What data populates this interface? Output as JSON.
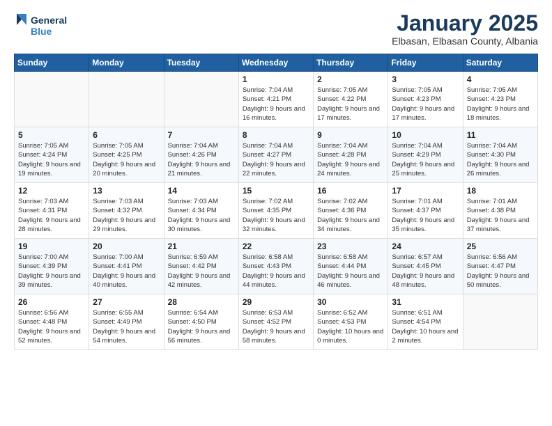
{
  "header": {
    "logo_line1": "General",
    "logo_line2": "Blue",
    "month": "January 2025",
    "location": "Elbasan, Elbasan County, Albania"
  },
  "weekdays": [
    "Sunday",
    "Monday",
    "Tuesday",
    "Wednesday",
    "Thursday",
    "Friday",
    "Saturday"
  ],
  "weeks": [
    [
      {
        "day": "",
        "info": ""
      },
      {
        "day": "",
        "info": ""
      },
      {
        "day": "",
        "info": ""
      },
      {
        "day": "1",
        "info": "Sunrise: 7:04 AM\nSunset: 4:21 PM\nDaylight: 9 hours and 16 minutes."
      },
      {
        "day": "2",
        "info": "Sunrise: 7:05 AM\nSunset: 4:22 PM\nDaylight: 9 hours and 17 minutes."
      },
      {
        "day": "3",
        "info": "Sunrise: 7:05 AM\nSunset: 4:23 PM\nDaylight: 9 hours and 17 minutes."
      },
      {
        "day": "4",
        "info": "Sunrise: 7:05 AM\nSunset: 4:23 PM\nDaylight: 9 hours and 18 minutes."
      }
    ],
    [
      {
        "day": "5",
        "info": "Sunrise: 7:05 AM\nSunset: 4:24 PM\nDaylight: 9 hours and 19 minutes."
      },
      {
        "day": "6",
        "info": "Sunrise: 7:05 AM\nSunset: 4:25 PM\nDaylight: 9 hours and 20 minutes."
      },
      {
        "day": "7",
        "info": "Sunrise: 7:04 AM\nSunset: 4:26 PM\nDaylight: 9 hours and 21 minutes."
      },
      {
        "day": "8",
        "info": "Sunrise: 7:04 AM\nSunset: 4:27 PM\nDaylight: 9 hours and 22 minutes."
      },
      {
        "day": "9",
        "info": "Sunrise: 7:04 AM\nSunset: 4:28 PM\nDaylight: 9 hours and 24 minutes."
      },
      {
        "day": "10",
        "info": "Sunrise: 7:04 AM\nSunset: 4:29 PM\nDaylight: 9 hours and 25 minutes."
      },
      {
        "day": "11",
        "info": "Sunrise: 7:04 AM\nSunset: 4:30 PM\nDaylight: 9 hours and 26 minutes."
      }
    ],
    [
      {
        "day": "12",
        "info": "Sunrise: 7:03 AM\nSunset: 4:31 PM\nDaylight: 9 hours and 28 minutes."
      },
      {
        "day": "13",
        "info": "Sunrise: 7:03 AM\nSunset: 4:32 PM\nDaylight: 9 hours and 29 minutes."
      },
      {
        "day": "14",
        "info": "Sunrise: 7:03 AM\nSunset: 4:34 PM\nDaylight: 9 hours and 30 minutes."
      },
      {
        "day": "15",
        "info": "Sunrise: 7:02 AM\nSunset: 4:35 PM\nDaylight: 9 hours and 32 minutes."
      },
      {
        "day": "16",
        "info": "Sunrise: 7:02 AM\nSunset: 4:36 PM\nDaylight: 9 hours and 34 minutes."
      },
      {
        "day": "17",
        "info": "Sunrise: 7:01 AM\nSunset: 4:37 PM\nDaylight: 9 hours and 35 minutes."
      },
      {
        "day": "18",
        "info": "Sunrise: 7:01 AM\nSunset: 4:38 PM\nDaylight: 9 hours and 37 minutes."
      }
    ],
    [
      {
        "day": "19",
        "info": "Sunrise: 7:00 AM\nSunset: 4:39 PM\nDaylight: 9 hours and 39 minutes."
      },
      {
        "day": "20",
        "info": "Sunrise: 7:00 AM\nSunset: 4:41 PM\nDaylight: 9 hours and 40 minutes."
      },
      {
        "day": "21",
        "info": "Sunrise: 6:59 AM\nSunset: 4:42 PM\nDaylight: 9 hours and 42 minutes."
      },
      {
        "day": "22",
        "info": "Sunrise: 6:58 AM\nSunset: 4:43 PM\nDaylight: 9 hours and 44 minutes."
      },
      {
        "day": "23",
        "info": "Sunrise: 6:58 AM\nSunset: 4:44 PM\nDaylight: 9 hours and 46 minutes."
      },
      {
        "day": "24",
        "info": "Sunrise: 6:57 AM\nSunset: 4:45 PM\nDaylight: 9 hours and 48 minutes."
      },
      {
        "day": "25",
        "info": "Sunrise: 6:56 AM\nSunset: 4:47 PM\nDaylight: 9 hours and 50 minutes."
      }
    ],
    [
      {
        "day": "26",
        "info": "Sunrise: 6:56 AM\nSunset: 4:48 PM\nDaylight: 9 hours and 52 minutes."
      },
      {
        "day": "27",
        "info": "Sunrise: 6:55 AM\nSunset: 4:49 PM\nDaylight: 9 hours and 54 minutes."
      },
      {
        "day": "28",
        "info": "Sunrise: 6:54 AM\nSunset: 4:50 PM\nDaylight: 9 hours and 56 minutes."
      },
      {
        "day": "29",
        "info": "Sunrise: 6:53 AM\nSunset: 4:52 PM\nDaylight: 9 hours and 58 minutes."
      },
      {
        "day": "30",
        "info": "Sunrise: 6:52 AM\nSunset: 4:53 PM\nDaylight: 10 hours and 0 minutes."
      },
      {
        "day": "31",
        "info": "Sunrise: 6:51 AM\nSunset: 4:54 PM\nDaylight: 10 hours and 2 minutes."
      },
      {
        "day": "",
        "info": ""
      }
    ]
  ]
}
